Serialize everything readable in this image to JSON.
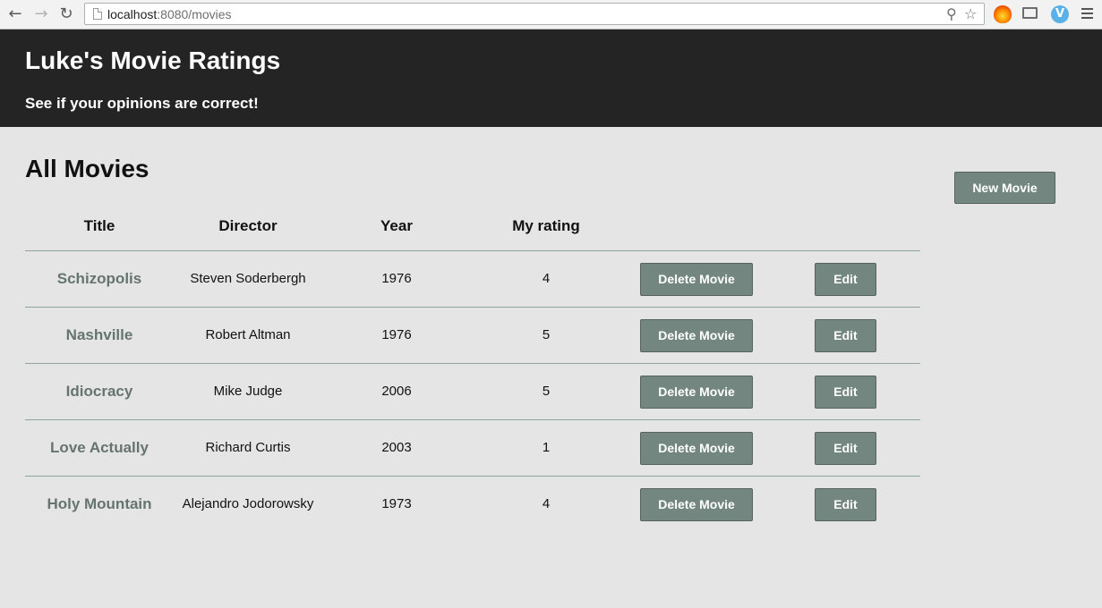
{
  "browser": {
    "url_host": "localhost",
    "url_rest": ":8080/movies",
    "icons": [
      "back-arrow-icon",
      "forward-arrow-icon",
      "reload-icon",
      "search-icon",
      "star-icon",
      "fire-extension-icon",
      "cast-icon",
      "v-extension-icon",
      "menu-icon"
    ],
    "v_icon_letter": "V"
  },
  "header": {
    "title": "Luke's Movie Ratings",
    "subtitle": "See if your opinions are correct!"
  },
  "main": {
    "title": "All Movies",
    "new_button": "New Movie",
    "columns": [
      "Title",
      "Director",
      "Year",
      "My rating"
    ],
    "delete_label": "Delete Movie",
    "edit_label": "Edit",
    "movies": [
      {
        "title": "Schizopolis",
        "director": "Steven Soderbergh",
        "year": "1976",
        "rating": "4"
      },
      {
        "title": "Nashville",
        "director": "Robert Altman",
        "year": "1976",
        "rating": "5"
      },
      {
        "title": "Idiocracy",
        "director": "Mike Judge",
        "year": "2006",
        "rating": "5"
      },
      {
        "title": "Love Actually",
        "director": "Richard Curtis",
        "year": "2003",
        "rating": "1"
      },
      {
        "title": "Holy Mountain",
        "director": "Alejandro Jodorowsky",
        "year": "1973",
        "rating": "4"
      }
    ]
  },
  "colors": {
    "header_bg": "#242424",
    "page_bg": "#e5e5e5",
    "button_bg": "#738780",
    "link_color": "#667470",
    "divider": "#8fa39c"
  }
}
